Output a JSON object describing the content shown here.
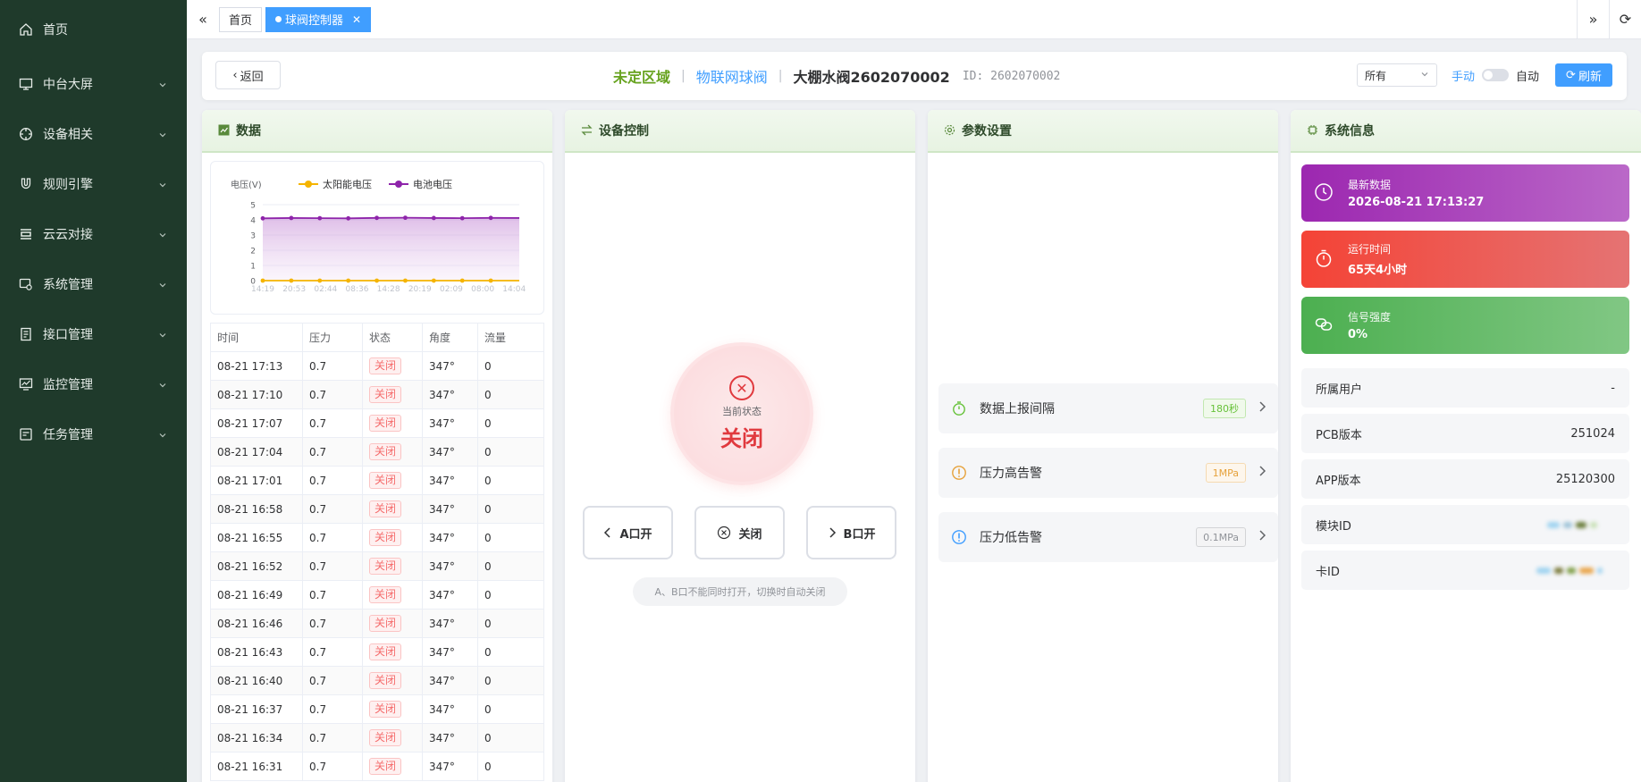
{
  "sidebar": {
    "items": [
      {
        "label": "首页",
        "icon": "home-icon",
        "caret": false
      },
      {
        "label": "中台大屏",
        "icon": "monitor-icon",
        "caret": true
      },
      {
        "label": "设备相关",
        "icon": "compass-icon",
        "caret": true
      },
      {
        "label": "规则引擎",
        "icon": "magnet-icon",
        "caret": true
      },
      {
        "label": "云云对接",
        "icon": "server-icon",
        "caret": true
      },
      {
        "label": "系统管理",
        "icon": "settings-icon",
        "caret": true
      },
      {
        "label": "接口管理",
        "icon": "document-icon",
        "caret": true
      },
      {
        "label": "监控管理",
        "icon": "chart-monitor-icon",
        "caret": true
      },
      {
        "label": "任务管理",
        "icon": "task-icon",
        "caret": true
      }
    ]
  },
  "tabs": {
    "home": "首页",
    "active": "球阀控制器"
  },
  "header": {
    "back_label": "返回",
    "area": "未定区域",
    "type": "物联网球阀",
    "device_name": "大棚水阀2602070002",
    "device_id": "ID: 2602070002",
    "filter_value": "所有",
    "mode_manual": "手动",
    "mode_auto": "自动",
    "refresh_label": "刷新"
  },
  "panels": {
    "data_title": "数据",
    "control_title": "设备控制",
    "params_title": "参数设置",
    "system_title": "系统信息"
  },
  "chart_data": {
    "type": "line",
    "ylabel": "电压(V)",
    "ylim": [
      0,
      5
    ],
    "yticks": [
      0,
      1,
      2,
      3,
      4,
      5
    ],
    "categories": [
      "14:19",
      "20:53",
      "02:44",
      "08:36",
      "14:28",
      "20:19",
      "02:09",
      "08:00",
      "14:04"
    ],
    "series": [
      {
        "name": "太阳能电压",
        "color": "#f5b400",
        "values": [
          0,
          0,
          0,
          0,
          0,
          0,
          0,
          0,
          0,
          0
        ]
      },
      {
        "name": "电池电压",
        "color": "#8e24aa",
        "values": [
          4.1,
          4.12,
          4.11,
          4.1,
          4.13,
          4.14,
          4.12,
          4.11,
          4.13,
          4.12
        ]
      }
    ],
    "grid": true,
    "legend": "top"
  },
  "table": {
    "headers": [
      "时间",
      "压力",
      "状态",
      "角度",
      "流量"
    ],
    "rows": [
      {
        "time": "08-21 17:13",
        "pressure": "0.7",
        "status": "关闭",
        "angle": "347°",
        "flow": "0"
      },
      {
        "time": "08-21 17:10",
        "pressure": "0.7",
        "status": "关闭",
        "angle": "347°",
        "flow": "0"
      },
      {
        "time": "08-21 17:07",
        "pressure": "0.7",
        "status": "关闭",
        "angle": "347°",
        "flow": "0"
      },
      {
        "time": "08-21 17:04",
        "pressure": "0.7",
        "status": "关闭",
        "angle": "347°",
        "flow": "0"
      },
      {
        "time": "08-21 17:01",
        "pressure": "0.7",
        "status": "关闭",
        "angle": "347°",
        "flow": "0"
      },
      {
        "time": "08-21 16:58",
        "pressure": "0.7",
        "status": "关闭",
        "angle": "347°",
        "flow": "0"
      },
      {
        "time": "08-21 16:55",
        "pressure": "0.7",
        "status": "关闭",
        "angle": "347°",
        "flow": "0"
      },
      {
        "time": "08-21 16:52",
        "pressure": "0.7",
        "status": "关闭",
        "angle": "347°",
        "flow": "0"
      },
      {
        "time": "08-21 16:49",
        "pressure": "0.7",
        "status": "关闭",
        "angle": "347°",
        "flow": "0"
      },
      {
        "time": "08-21 16:46",
        "pressure": "0.7",
        "status": "关闭",
        "angle": "347°",
        "flow": "0"
      },
      {
        "time": "08-21 16:43",
        "pressure": "0.7",
        "status": "关闭",
        "angle": "347°",
        "flow": "0"
      },
      {
        "time": "08-21 16:40",
        "pressure": "0.7",
        "status": "关闭",
        "angle": "347°",
        "flow": "0"
      },
      {
        "time": "08-21 16:37",
        "pressure": "0.7",
        "status": "关闭",
        "angle": "347°",
        "flow": "0"
      },
      {
        "time": "08-21 16:34",
        "pressure": "0.7",
        "status": "关闭",
        "angle": "347°",
        "flow": "0"
      },
      {
        "time": "08-21 16:31",
        "pressure": "0.7",
        "status": "关闭",
        "angle": "347°",
        "flow": "0"
      }
    ]
  },
  "control": {
    "status_label": "当前状态",
    "status_value": "关闭",
    "btn_a": "A口开",
    "btn_close": "关闭",
    "btn_b": "B口开",
    "hint": "A、B口不能同时打开，切换时自动关闭"
  },
  "params": {
    "report_interval": {
      "label": "数据上报间隔",
      "value": "180秒",
      "color": "#67c23a"
    },
    "pressure_high": {
      "label": "压力高告警",
      "value": "1MPa",
      "color": "#e6a23c"
    },
    "pressure_low": {
      "label": "压力低告警",
      "value": "0.1MPa",
      "color": "#909399"
    }
  },
  "system": {
    "latest": {
      "label": "最新数据",
      "value": "2026-08-21 17:13:27"
    },
    "runtime": {
      "label": "运行时间",
      "value": "65天4小时"
    },
    "signal": {
      "label": "信号强度",
      "value": "0%"
    },
    "owner": {
      "label": "所属用户",
      "value": "-"
    },
    "pcb": {
      "label": "PCB版本",
      "value": "251024"
    },
    "app": {
      "label": "APP版本",
      "value": "25120300"
    },
    "module_id": {
      "label": "模块ID"
    },
    "card_id": {
      "label": "卡ID"
    }
  }
}
